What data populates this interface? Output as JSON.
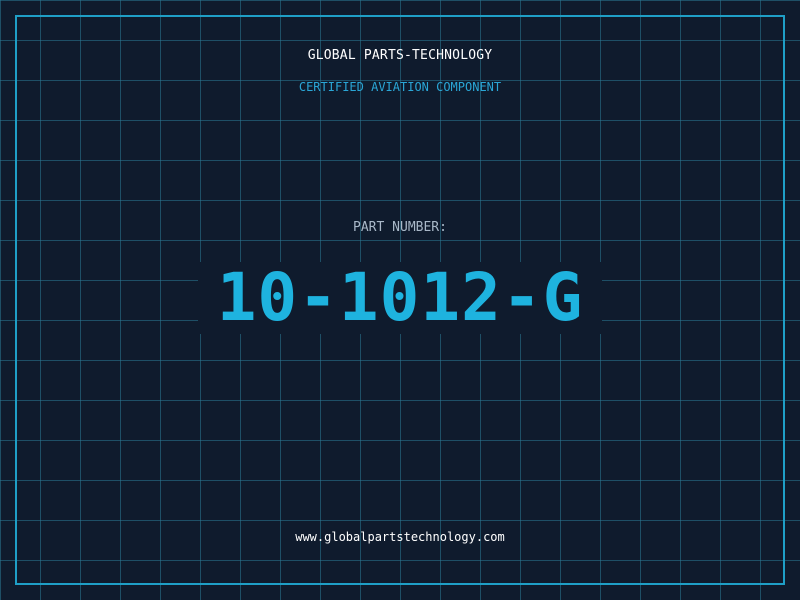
{
  "header": {
    "company": "GLOBAL PARTS-TECHNOLOGY",
    "subtitle": "CERTIFIED AVIATION COMPONENT"
  },
  "part": {
    "label": "PART NUMBER:",
    "number": "10-1012-G"
  },
  "footer": {
    "website": "www.globalpartstechnology.com"
  },
  "colors": {
    "background": "#0f1b2d",
    "grid": "#2a7a96",
    "frame": "#1f9fc7",
    "accent": "#1eb3df",
    "label": "#a9b8c8",
    "text": "#ffffff"
  }
}
